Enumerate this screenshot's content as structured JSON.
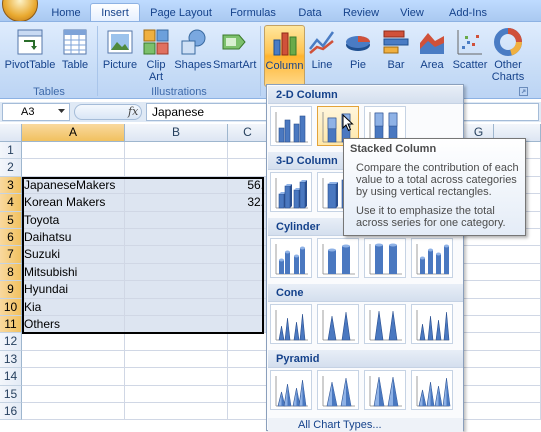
{
  "tabs": [
    "Home",
    "Insert",
    "Page Layout",
    "Formulas",
    "Data",
    "Review",
    "View",
    "Add-Ins"
  ],
  "active_tab": "Insert",
  "ribbon": {
    "tables_group": {
      "label": "Tables",
      "pivot_label": "PivotTable",
      "table_label": "Table"
    },
    "illustrations_group": {
      "label": "Illustrations",
      "picture_label": "Picture",
      "clip_label_1": "Clip",
      "clip_label_2": "Art",
      "shapes_label": "Shapes",
      "smartart_label": "SmartArt"
    },
    "charts_group": {
      "column_label": "Column",
      "line_label": "Line",
      "pie_label": "Pie",
      "bar_label": "Bar",
      "area_label": "Area",
      "scatter_label": "Scatter",
      "other_label_1": "Other",
      "other_label_2": "Charts"
    }
  },
  "formula_bar": {
    "name_box": "A3",
    "fx": "fx",
    "formula": "Japanese"
  },
  "columns": [
    "A",
    "B",
    "C",
    "G"
  ],
  "rows": [
    {
      "num": "1",
      "a": "",
      "c": ""
    },
    {
      "num": "2",
      "a": "",
      "c": ""
    },
    {
      "num": "3",
      "a": "JapaneseMakers",
      "c": "56."
    },
    {
      "num": "4",
      "a": "Korean Makers",
      "c": "32."
    },
    {
      "num": "5",
      "a": "Toyota",
      "c": ""
    },
    {
      "num": "6",
      "a": "Daihatsu",
      "c": ""
    },
    {
      "num": "7",
      "a": "Suzuki",
      "c": ""
    },
    {
      "num": "8",
      "a": "Mitsubishi",
      "c": ""
    },
    {
      "num": "9",
      "a": "Hyundai",
      "c": ""
    },
    {
      "num": "10",
      "a": "Kia",
      "c": ""
    },
    {
      "num": "11",
      "a": "Others",
      "c": ""
    },
    {
      "num": "12",
      "a": "",
      "c": ""
    },
    {
      "num": "13",
      "a": "",
      "c": ""
    },
    {
      "num": "14",
      "a": "",
      "c": ""
    },
    {
      "num": "15",
      "a": "",
      "c": ""
    },
    {
      "num": "16",
      "a": "",
      "c": ""
    }
  ],
  "gallery": {
    "sections": [
      "2-D Column",
      "3-D Column",
      "Cylinder",
      "Cone",
      "Pyramid"
    ],
    "more_label": "All Chart Types..."
  },
  "tooltip": {
    "title": "Stacked Column",
    "description": "Compare the contribution of each value to a total across categories by using vertical rectangles.",
    "usage": "Use it to emphasize the total across series for one category."
  },
  "colors": {
    "ribbon_text": "#15428b",
    "selected_button": "#ffc34f",
    "header_selected": "#f1c15f",
    "selection_fill": "#dde5f1"
  }
}
